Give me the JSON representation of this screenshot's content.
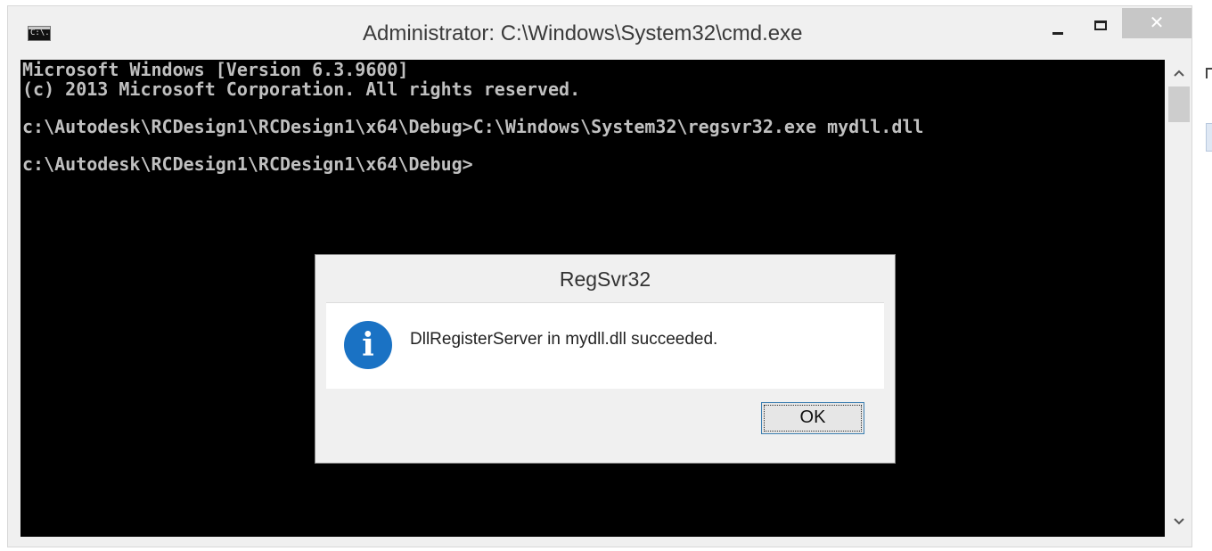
{
  "window": {
    "title": "Administrator: C:\\Windows\\System32\\cmd.exe",
    "icon": "console-icon",
    "icon_text": "C:\\.",
    "minimize_icon": "minimize-icon",
    "maximize_icon": "maximize-icon",
    "close_label": "✕"
  },
  "console": {
    "lines": [
      "Microsoft Windows [Version 6.3.9600]",
      "(c) 2013 Microsoft Corporation. All rights reserved.",
      "c:\\Autodesk\\RCDesign1\\RCDesign1\\x64\\Debug>C:\\Windows\\System32\\regsvr32.exe mydll.dll",
      "c:\\Autodesk\\RCDesign1\\RCDesign1\\x64\\Debug>"
    ],
    "background": "#000000",
    "foreground": "#c0c0c0"
  },
  "scrollbar": {
    "up_glyph": "^",
    "down_glyph": "v"
  },
  "dialog": {
    "title": "RegSvr32",
    "message": "DllRegisterServer in mydll.dll succeeded.",
    "icon": "info-icon",
    "icon_glyph": "i",
    "ok_label": "OK",
    "accent": "#1a72c4"
  }
}
